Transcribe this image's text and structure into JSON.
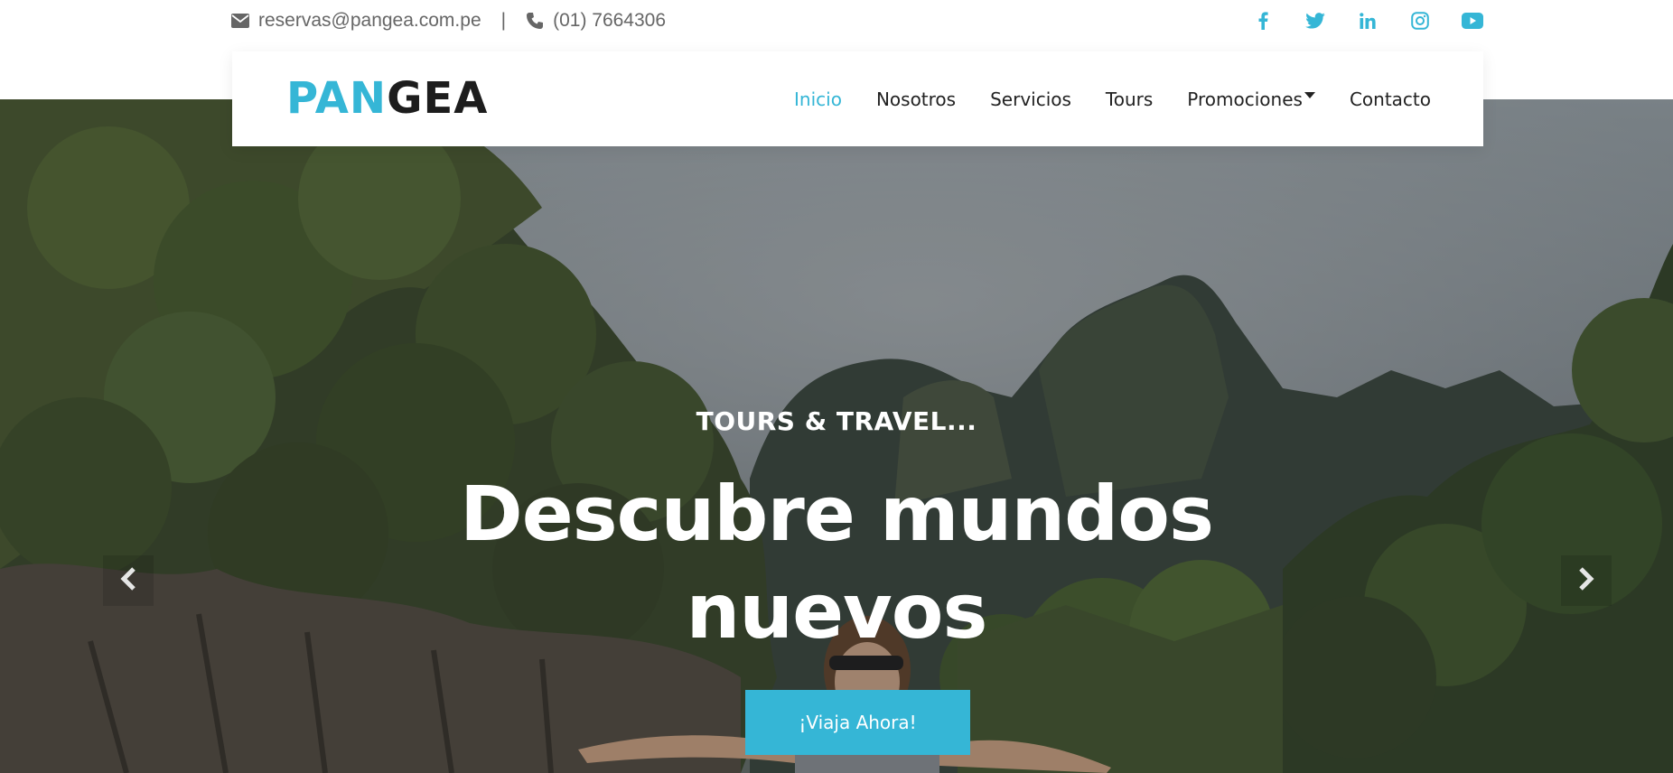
{
  "topbar": {
    "email": "reservas@pangea.com.pe",
    "separator": "|",
    "phone": "(01) 7664306",
    "icons": [
      "envelope-icon",
      "phone-icon"
    ],
    "socials": [
      "facebook-icon",
      "twitter-icon",
      "linkedin-icon",
      "instagram-icon",
      "youtube-icon"
    ]
  },
  "brand": {
    "part1": "PAN",
    "part2": "GEA"
  },
  "nav": {
    "items": [
      {
        "label": "Inicio",
        "active": true
      },
      {
        "label": "Nosotros"
      },
      {
        "label": "Servicios"
      },
      {
        "label": "Tours"
      },
      {
        "label": "Promociones",
        "dropdown": true
      },
      {
        "label": "Contacto"
      }
    ]
  },
  "hero": {
    "subtitle": "TOURS & TRAVEL...",
    "headline": "Descubre mundos nuevos",
    "cta": "¡Viaja Ahora!"
  },
  "colors": {
    "accent": "#35b6d6",
    "brand_dark": "#1d1d1d",
    "text": "#222222",
    "muted": "#666666"
  },
  "carousel": {
    "prev_icon": "chevron-left-icon",
    "next_icon": "chevron-right-icon"
  }
}
